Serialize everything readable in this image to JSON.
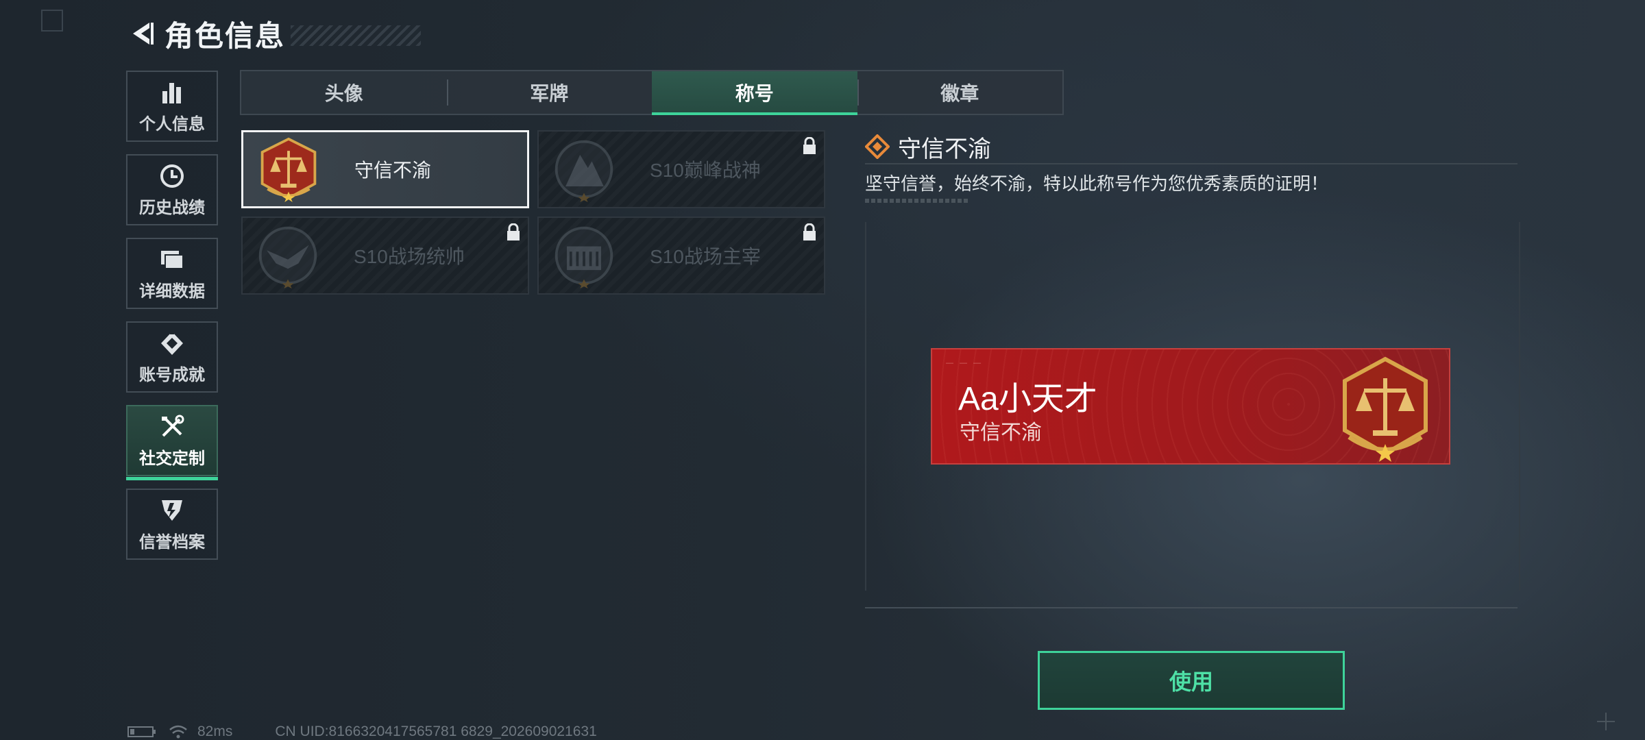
{
  "header": {
    "title": "角色信息"
  },
  "sidebar": {
    "items": [
      {
        "label": "个人信息",
        "icon": "bar-chart-icon"
      },
      {
        "label": "历史战绩",
        "icon": "clock-icon"
      },
      {
        "label": "详细数据",
        "icon": "folder-icon"
      },
      {
        "label": "账号成就",
        "icon": "achievement-icon"
      },
      {
        "label": "社交定制",
        "icon": "tools-icon",
        "active": true
      },
      {
        "label": "信誉档案",
        "icon": "shield-icon"
      }
    ]
  },
  "tabs": [
    {
      "label": "头像"
    },
    {
      "label": "军牌"
    },
    {
      "label": "称号",
      "active": true
    },
    {
      "label": "徽章"
    }
  ],
  "titles": [
    {
      "name": "守信不渝",
      "locked": false,
      "selected": true
    },
    {
      "name": "S10巅峰战神",
      "locked": true
    },
    {
      "name": "S10战场统帅",
      "locked": true
    },
    {
      "name": "S10战场主宰",
      "locked": true
    }
  ],
  "detail": {
    "name": "守信不渝",
    "description": "坚守信誉，始终不渝，特以此称号作为您优秀素质的证明！"
  },
  "banner": {
    "player_name": "Aa小天才",
    "title": "守信不渝"
  },
  "use_button": {
    "label": "使用"
  },
  "status": {
    "ping": "82ms",
    "uid": "CN UID:8166320417565781 6829_202609021631"
  },
  "colors": {
    "accent": "#3ed39a",
    "banner_red": "#b0191c",
    "emblem_gold": "#d8a64a"
  }
}
